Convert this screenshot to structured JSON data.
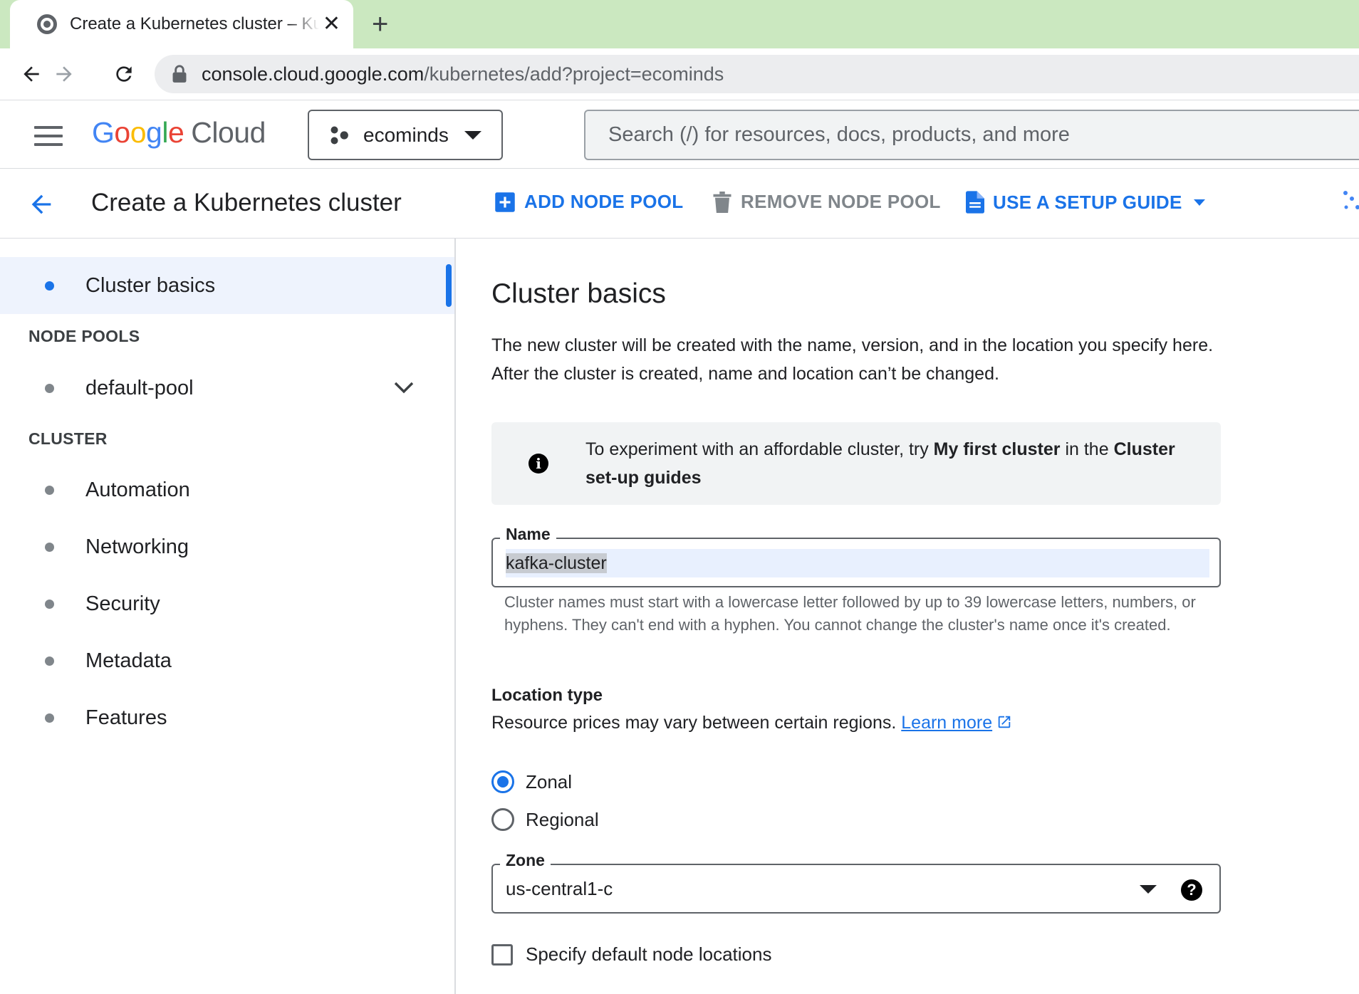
{
  "browser": {
    "tab_title": "Create a Kubernetes cluster – Kubernetes Engine",
    "new_tab_symbol": "+",
    "close_symbol": "✕",
    "url_host": "console.cloud.google.com",
    "url_path": "/kubernetes/add?project=ecominds"
  },
  "header": {
    "logo_google": [
      "G",
      "o",
      "o",
      "g",
      "l",
      "e"
    ],
    "logo_cloud": "Cloud",
    "project": "ecominds",
    "search_placeholder": "Search (/) for resources, docs, products, and more"
  },
  "actionbar": {
    "title": "Create a Kubernetes cluster",
    "add_node_pool": "ADD NODE POOL",
    "remove_node_pool": "REMOVE NODE POOL",
    "setup_guide": "USE A SETUP GUIDE"
  },
  "sidebar": {
    "cluster_basics": "Cluster basics",
    "node_pools_heading": "NODE POOLS",
    "default_pool": "default-pool",
    "cluster_heading": "CLUSTER",
    "items": [
      "Automation",
      "Networking",
      "Security",
      "Metadata",
      "Features"
    ]
  },
  "main": {
    "heading": "Cluster basics",
    "intro": "The new cluster will be created with the name, version, and in the location you specify here. After the cluster is created, name and location can’t be changed.",
    "info": {
      "prefix": "To experiment with an affordable cluster, try ",
      "bold1": "My first cluster",
      "middle": " in the ",
      "bold2": "Cluster set-up guides"
    },
    "name_label": "Name",
    "name_value": "kafka-cluster",
    "name_hint": "Cluster names must start with a lowercase letter followed by up to 39 lowercase letters, numbers, or hyphens. They can't end with a hyphen. You cannot change the cluster's name once it's created.",
    "location_heading": "Location type",
    "location_text": "Resource prices may vary between certain regions. ",
    "learn_more": "Learn more",
    "radio_zonal": "Zonal",
    "radio_regional": "Regional",
    "selected_location_type": "Zonal",
    "zone_label": "Zone",
    "zone_value": "us-central1-c",
    "help_symbol": "?",
    "info_symbol": "i",
    "checkbox_label": "Specify default node locations"
  },
  "colors": {
    "accent": "#1a73e8",
    "tabstrip": "#cbe8c0",
    "active_nav_bg": "#eef3fd"
  }
}
